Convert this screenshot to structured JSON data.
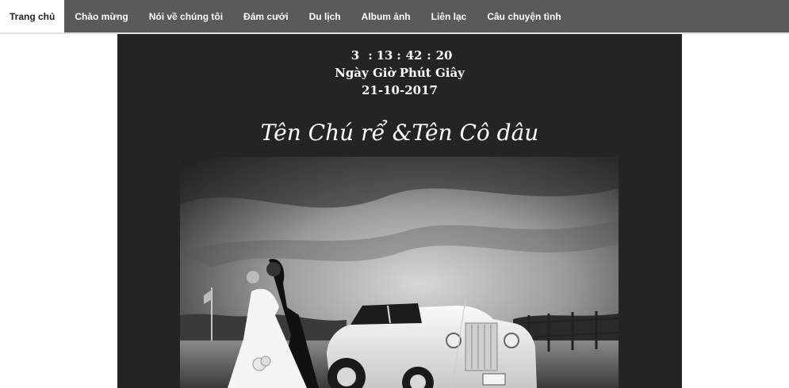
{
  "nav": {
    "items": [
      {
        "label": "Trang chủ",
        "active": true
      },
      {
        "label": "Chào mừng"
      },
      {
        "label": "Nói về chúng tôi"
      },
      {
        "label": "Đám cưới"
      },
      {
        "label": "Du lịch"
      },
      {
        "label": "Album ảnh"
      },
      {
        "label": "Liên lạc"
      },
      {
        "label": "Câu chuyện tình"
      }
    ]
  },
  "countdown": {
    "days": "3",
    "hours": "13",
    "minutes": "42",
    "seconds": "20",
    "units_label": "Ngày Giờ Phút Giây",
    "date": "21-10-2017"
  },
  "couple": {
    "names": "Tên Chú rể &Tên Cô dâu"
  },
  "colors": {
    "nav_bg": "#5a5a5a",
    "panel_bg": "#242424",
    "active_tab_bg": "#ffffff"
  }
}
